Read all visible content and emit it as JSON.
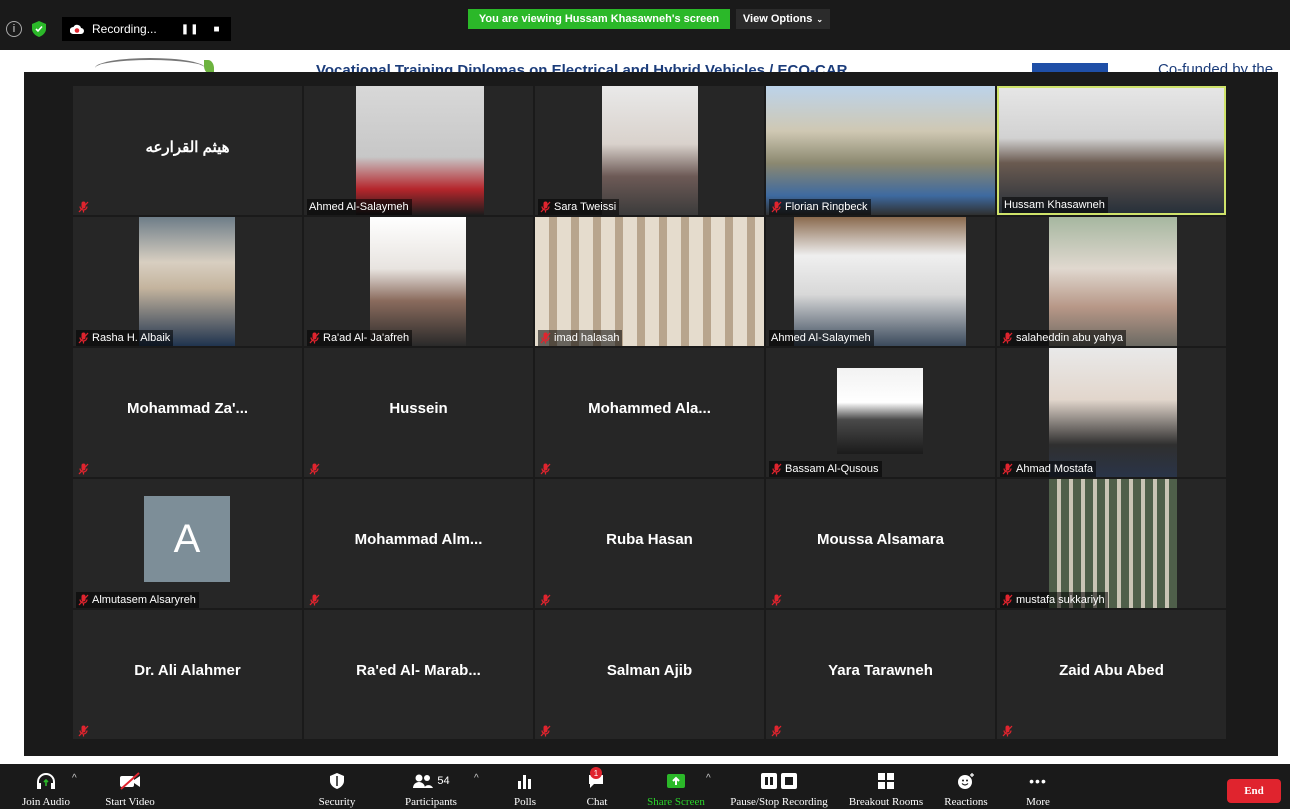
{
  "topbar": {
    "recording_label": "Recording...",
    "share_banner": "You are viewing Hussam Khasawneh's screen",
    "view_options": "View Options"
  },
  "shared_screen": {
    "title_fragment": "Vocational Training Diplomas on Electrical and Hybrid Vehicles / ECO-CAR",
    "cofunded": "Co-funded by the"
  },
  "tiles": [
    {
      "name": "هيثم القرارعه",
      "video": false,
      "muted": true
    },
    {
      "name": "Ahmed Al-Salaymeh",
      "video": true,
      "muted": false
    },
    {
      "name": "Sara Tweissi",
      "video": true,
      "muted": true
    },
    {
      "name": "Florian Ringbeck",
      "video": true,
      "muted": true
    },
    {
      "name": "Hussam Khasawneh",
      "video": true,
      "muted": false,
      "active_speaker": true
    },
    {
      "name": "Rasha H. Albaik",
      "video": true,
      "muted": true
    },
    {
      "name": "Ra'ad Al- Ja'afreh",
      "video": true,
      "muted": true
    },
    {
      "name": "imad halasah",
      "video": true,
      "muted": true
    },
    {
      "name": "Ahmed Al-Salaymeh",
      "video": true,
      "muted": false
    },
    {
      "name": "salaheddin abu yahya",
      "video": true,
      "muted": true
    },
    {
      "name": "Mohammad Za'...",
      "video": false,
      "muted": true
    },
    {
      "name": "Hussein",
      "video": false,
      "muted": true
    },
    {
      "name": "Mohammed Ala...",
      "video": false,
      "muted": true
    },
    {
      "name": "Bassam Al-Qusous",
      "video": true,
      "muted": true
    },
    {
      "name": "Ahmad Mostafa",
      "video": true,
      "muted": true
    },
    {
      "name": "Almutasem Alsaryreh",
      "video": false,
      "avatar_letter": "A",
      "muted": true
    },
    {
      "name": "Mohammad Alm...",
      "video": false,
      "muted": true
    },
    {
      "name": "Ruba Hasan",
      "video": false,
      "muted": true
    },
    {
      "name": "Moussa Alsamara",
      "video": false,
      "muted": true
    },
    {
      "name": "mustafa sukkariyh",
      "video": true,
      "muted": true
    },
    {
      "name": "Dr. Ali Alahmer",
      "video": false,
      "muted": true
    },
    {
      "name": "Ra'ed Al- Marab...",
      "video": false,
      "muted": false
    },
    {
      "name": "Salman Ajib",
      "video": false,
      "muted": true
    },
    {
      "name": "Yara Tarawneh",
      "video": false,
      "muted": true
    },
    {
      "name": "Zaid Abu Abed",
      "video": false,
      "muted": true
    }
  ],
  "toolbar": {
    "join_audio": "Join Audio",
    "start_video": "Start Video",
    "security": "Security",
    "participants": "Participants",
    "participants_count": "54",
    "polls": "Polls",
    "chat": "Chat",
    "chat_badge": "1",
    "share_screen": "Share Screen",
    "pause_stop_recording": "Pause/Stop Recording",
    "breakout_rooms": "Breakout Rooms",
    "reactions": "Reactions",
    "more": "More",
    "end": "End"
  },
  "colors": {
    "share_banner": "#2bb829",
    "share_screen_text": "#2bd42b",
    "end_button": "#e0242e",
    "mute_icon": "#e0242e",
    "active_border": "#cfe36a"
  }
}
